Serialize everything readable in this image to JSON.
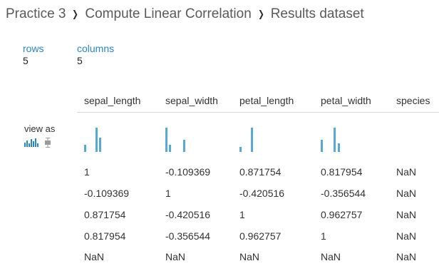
{
  "breadcrumb": {
    "items": [
      "Practice 3",
      "Compute Linear Correlation",
      "Results dataset"
    ],
    "separator": "›"
  },
  "summary": {
    "rows_label": "rows",
    "rows_value": "5",
    "columns_label": "columns",
    "columns_value": "5"
  },
  "columns": [
    "sepal_length",
    "sepal_width",
    "petal_length",
    "petal_width",
    "species"
  ],
  "view_as_label": "view as",
  "histograms": [
    [
      0.3,
      1.0,
      0.6
    ],
    [
      1.0,
      0.3,
      0.5
    ],
    [
      0.2,
      1.0
    ],
    [
      0.5,
      1.0,
      0.35
    ],
    []
  ],
  "rows": [
    [
      "1",
      "-0.109369",
      "0.871754",
      "0.817954",
      "NaN"
    ],
    [
      "-0.109369",
      "1",
      "-0.420516",
      "-0.356544",
      "NaN"
    ],
    [
      "0.871754",
      "-0.420516",
      "1",
      "0.962757",
      "NaN"
    ],
    [
      "0.817954",
      "-0.356544",
      "0.962757",
      "1",
      "NaN"
    ],
    [
      "NaN",
      "NaN",
      "NaN",
      "NaN",
      "NaN"
    ]
  ],
  "colors": {
    "accent": "#2d86c4",
    "bar": "#59a9d4",
    "text": "#333333"
  }
}
